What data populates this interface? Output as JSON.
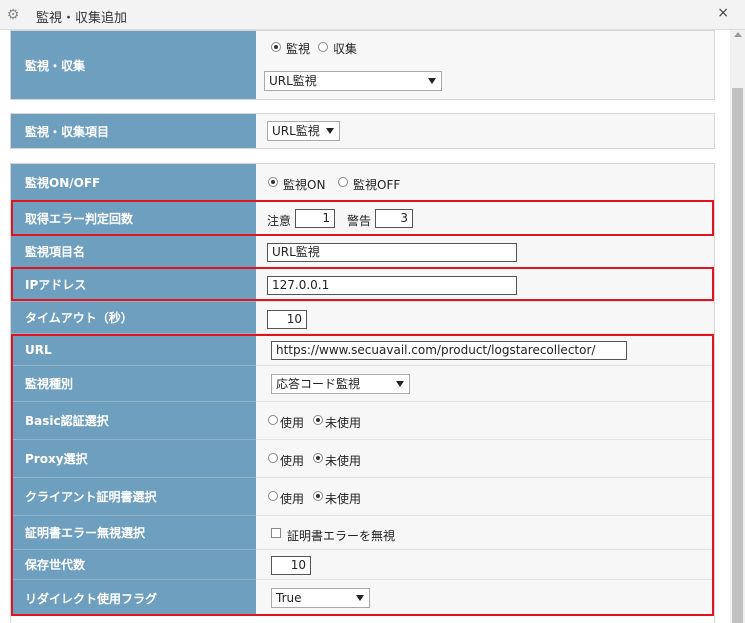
{
  "window": {
    "title": "監視・収集追加",
    "gear_icon": "gear-icon",
    "close_label": "×"
  },
  "colors": {
    "label_bg": "#6f9fbe",
    "highlight": "#e0141e"
  },
  "section1": {
    "label": "監視・収集",
    "radio_monitor": "監視",
    "radio_collect": "収集",
    "selected_radio": "監視",
    "type_select": "URL監視"
  },
  "section2": {
    "label": "監視・収集項目",
    "item_select": "URL監視"
  },
  "section3": {
    "onoff": {
      "label": "監視ON/OFF",
      "on": "監視ON",
      "off": "監視OFF",
      "selected": "監視ON"
    },
    "error_count": {
      "label": "取得エラー判定回数",
      "caution_label": "注意",
      "caution_value": "1",
      "warning_label": "警告",
      "warning_value": "3"
    },
    "item_name": {
      "label": "監視項目名",
      "value": "URL監視"
    },
    "ip": {
      "label": "IPアドレス",
      "value": "127.0.0.1"
    },
    "timeout": {
      "label": "タイムアウト（秒）",
      "value": "10"
    },
    "url": {
      "label": "URL",
      "value": "https://www.secuavail.com/product/logstarecollector/"
    },
    "monitor_type": {
      "label": "監視種別",
      "value": "応答コード監視"
    },
    "basic_auth": {
      "label": "Basic認証選択",
      "use": "使用",
      "unused": "未使用",
      "selected": "未使用"
    },
    "proxy": {
      "label": "Proxy選択",
      "use": "使用",
      "unused": "未使用",
      "selected": "未使用"
    },
    "client_cert": {
      "label": "クライアント証明書選択",
      "use": "使用",
      "unused": "未使用",
      "selected": "未使用"
    },
    "cert_error": {
      "label": "証明書エラー無視選択",
      "checkbox_label": "証明書エラーを無視",
      "checked": false
    },
    "generations": {
      "label": "保存世代数",
      "value": "10"
    },
    "redirect": {
      "label": "リダイレクト使用フラグ",
      "value": "True"
    }
  }
}
